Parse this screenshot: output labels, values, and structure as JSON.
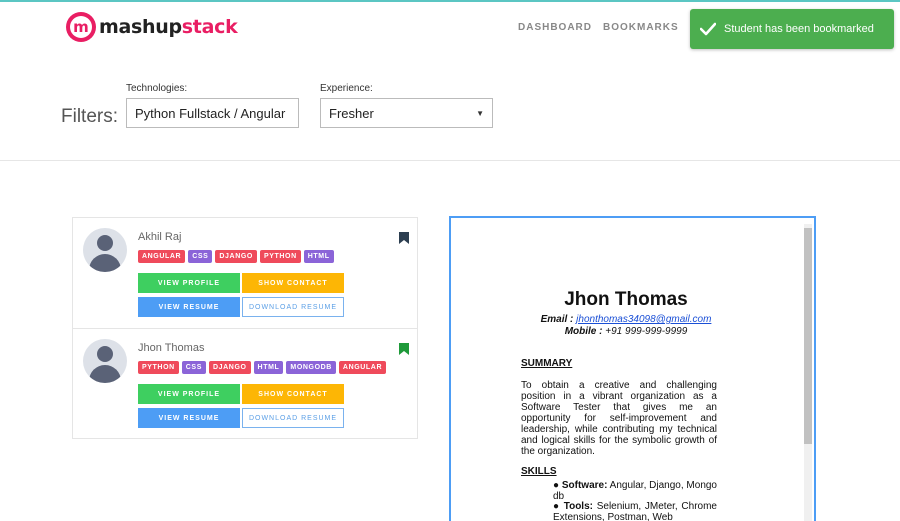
{
  "header": {
    "logo_mark": "m",
    "logo_text_a": "mashup",
    "logo_text_b": "stack",
    "nav": {
      "dashboard": "DASHBOARD",
      "bookmarks": "BOOKMARKS"
    }
  },
  "toast": {
    "message": "Student has been bookmarked",
    "icon": "check-icon",
    "color": "#4cae4f"
  },
  "filters": {
    "label": "Filters:",
    "technologies_label": "Technologies:",
    "technologies_value": "Python Fullstack / Angular",
    "experience_label": "Experience:",
    "experience_value": "Fresher"
  },
  "students": [
    {
      "name": "Akhil Raj",
      "tags": [
        "ANGULAR",
        "CSS",
        "DJANGO",
        "PYTHON",
        "HTML"
      ],
      "bookmarked": false,
      "bookmark_color": "#2c3e50",
      "buttons": {
        "view_profile": "VIEW PROFILE",
        "show_contact": "SHOW CONTACT",
        "view_resume": "VIEW RESUME",
        "download_resume": "DOWNLOAD RESUME"
      }
    },
    {
      "name": "Jhon Thomas",
      "tags": [
        "PYTHON",
        "CSS",
        "DJANGO",
        "HTML",
        "MONGODB",
        "ANGULAR"
      ],
      "bookmarked": true,
      "bookmark_color": "#1f9a3a",
      "buttons": {
        "view_profile": "VIEW PROFILE",
        "show_contact": "SHOW CONTACT",
        "view_resume": "VIEW RESUME",
        "download_resume": "DOWNLOAD RESUME"
      }
    }
  ],
  "resume": {
    "name": "Jhon Thomas",
    "email_label": "Email :",
    "email": "jhonthomas34098@gmail.com",
    "mobile_label": "Mobile :",
    "mobile": "+91 999-999-9999",
    "summary_heading": "SUMMARY",
    "summary": "To obtain a creative and challenging position in a vibrant organization as a Software Tester that gives me an opportunity for self-improvement and leadership, while contributing my technical and logical skills for the symbolic growth of the organization.",
    "skills_heading": "SKILLS",
    "skills": [
      {
        "label": "Software:",
        "value": "Angular, Django, Mongo db"
      },
      {
        "label": "Tools:",
        "value": "Selenium, JMeter, Chrome Extensions, Postman, Web"
      }
    ]
  }
}
